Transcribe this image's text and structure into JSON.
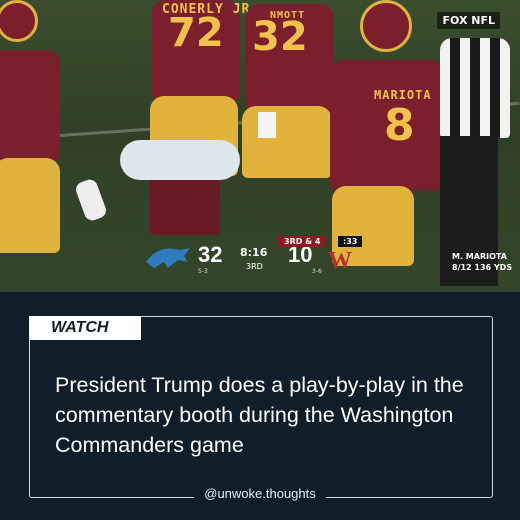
{
  "video": {
    "network": "FOX NFL",
    "players": {
      "p72_name": "CONERLY JR",
      "p72_number": "72",
      "p32_name": "NMOTT",
      "p32_number": "32",
      "p8_name": "MARIOTA",
      "p8_number": "8"
    },
    "scoreboard": {
      "home_score": "32",
      "home_record": "5-3",
      "clock": "8:16",
      "quarter": "3RD",
      "away_score": "10",
      "away_record": "3-6",
      "down_distance": "3RD & 4",
      "play_clock": ":33"
    },
    "stat_line1": "M. MARIOTA",
    "stat_line2": "8/12 136 YDS"
  },
  "caption": {
    "tag": "WATCH",
    "headline": "President Trump does a play-by-play in the commentary booth during the Washington Commanders game",
    "handle": "@unwoke.thoughts"
  },
  "colors": {
    "background": "#0f1e2a",
    "burgundy": "#7a1f2b",
    "gold": "#e2b33c"
  }
}
